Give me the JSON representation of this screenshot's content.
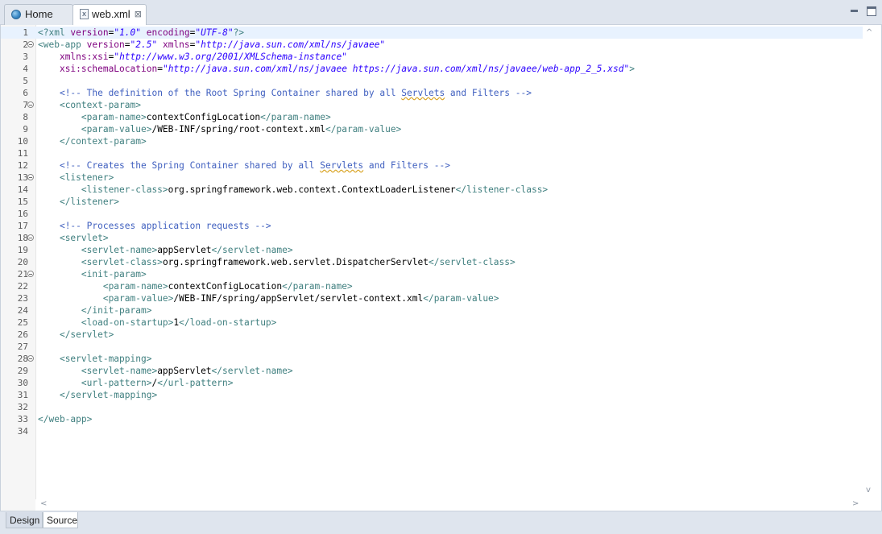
{
  "tabs": {
    "home": "Home",
    "file": "web.xml",
    "close_glyph": "⊠",
    "file_icon_glyph": "x"
  },
  "bottom_tabs": {
    "design": "Design",
    "source": "Source"
  },
  "scroll_glyphs": {
    "up": "^",
    "down": "v",
    "left": "<",
    "right": ">"
  },
  "colors": {
    "tag": "#3f7f7f",
    "attribute": "#7f007f",
    "attribute_value": "#2a00ff",
    "comment": "#3f5fbf",
    "current_line": "#e8f2fe"
  },
  "editor": {
    "current_line": 1,
    "lines": [
      {
        "n": "1",
        "fold": false,
        "parts": [
          [
            "tag",
            "<?xml "
          ],
          [
            "attr",
            "version"
          ],
          [
            "plain",
            "="
          ],
          [
            "val",
            "\"1.0\""
          ],
          [
            "plain",
            " "
          ],
          [
            "attr",
            "encoding"
          ],
          [
            "plain",
            "="
          ],
          [
            "val",
            "\"UTF-8\""
          ],
          [
            "tag",
            "?>"
          ]
        ]
      },
      {
        "n": "2",
        "fold": true,
        "parts": [
          [
            "tag",
            "<web-app "
          ],
          [
            "attr",
            "version"
          ],
          [
            "plain",
            "="
          ],
          [
            "val",
            "\"2.5\""
          ],
          [
            "plain",
            " "
          ],
          [
            "attr",
            "xmlns"
          ],
          [
            "plain",
            "="
          ],
          [
            "val",
            "\"http://java.sun.com/xml/ns/javaee\""
          ]
        ]
      },
      {
        "n": "3",
        "fold": false,
        "parts": [
          [
            "plain",
            "    "
          ],
          [
            "attr",
            "xmlns:xsi"
          ],
          [
            "plain",
            "="
          ],
          [
            "val",
            "\"http://www.w3.org/2001/XMLSchema-instance\""
          ]
        ]
      },
      {
        "n": "4",
        "fold": false,
        "parts": [
          [
            "plain",
            "    "
          ],
          [
            "attr",
            "xsi:schemaLocation"
          ],
          [
            "plain",
            "="
          ],
          [
            "val",
            "\"http://java.sun.com/xml/ns/javaee https://java.sun.com/xml/ns/javaee/web-app_2_5.xsd\""
          ],
          [
            "tag",
            ">"
          ]
        ]
      },
      {
        "n": "5",
        "fold": false,
        "parts": []
      },
      {
        "n": "6",
        "fold": false,
        "parts": [
          [
            "plain",
            "    "
          ],
          [
            "cmt",
            "<!-- The definition of the Root Spring Container shared by all "
          ],
          [
            "cmtspell",
            "Servlets"
          ],
          [
            "cmt",
            " and Filters -->"
          ]
        ]
      },
      {
        "n": "7",
        "fold": true,
        "parts": [
          [
            "plain",
            "    "
          ],
          [
            "tag",
            "<context-param>"
          ]
        ]
      },
      {
        "n": "8",
        "fold": false,
        "parts": [
          [
            "plain",
            "        "
          ],
          [
            "tag",
            "<param-name>"
          ],
          [
            "plain",
            "contextConfigLocation"
          ],
          [
            "tag",
            "</param-name>"
          ]
        ]
      },
      {
        "n": "9",
        "fold": false,
        "parts": [
          [
            "plain",
            "        "
          ],
          [
            "tag",
            "<param-value>"
          ],
          [
            "plain",
            "/WEB-INF/spring/root-context.xml"
          ],
          [
            "tag",
            "</param-value>"
          ]
        ]
      },
      {
        "n": "10",
        "fold": false,
        "parts": [
          [
            "plain",
            "    "
          ],
          [
            "tag",
            "</context-param>"
          ]
        ]
      },
      {
        "n": "11",
        "fold": false,
        "parts": []
      },
      {
        "n": "12",
        "fold": false,
        "parts": [
          [
            "plain",
            "    "
          ],
          [
            "cmt",
            "<!-- Creates the Spring Container shared by all "
          ],
          [
            "cmtspell",
            "Servlets"
          ],
          [
            "cmt",
            " and Filters -->"
          ]
        ]
      },
      {
        "n": "13",
        "fold": true,
        "parts": [
          [
            "plain",
            "    "
          ],
          [
            "tag",
            "<listener>"
          ]
        ]
      },
      {
        "n": "14",
        "fold": false,
        "parts": [
          [
            "plain",
            "        "
          ],
          [
            "tag",
            "<listener-class>"
          ],
          [
            "plain",
            "org.springframework.web.context.ContextLoaderListener"
          ],
          [
            "tag",
            "</listener-class>"
          ]
        ]
      },
      {
        "n": "15",
        "fold": false,
        "parts": [
          [
            "plain",
            "    "
          ],
          [
            "tag",
            "</listener>"
          ]
        ]
      },
      {
        "n": "16",
        "fold": false,
        "parts": []
      },
      {
        "n": "17",
        "fold": false,
        "parts": [
          [
            "plain",
            "    "
          ],
          [
            "cmt",
            "<!-- Processes application requests -->"
          ]
        ]
      },
      {
        "n": "18",
        "fold": true,
        "parts": [
          [
            "plain",
            "    "
          ],
          [
            "tag",
            "<servlet>"
          ]
        ]
      },
      {
        "n": "19",
        "fold": false,
        "parts": [
          [
            "plain",
            "        "
          ],
          [
            "tag",
            "<servlet-name>"
          ],
          [
            "plain",
            "appServlet"
          ],
          [
            "tag",
            "</servlet-name>"
          ]
        ]
      },
      {
        "n": "20",
        "fold": false,
        "parts": [
          [
            "plain",
            "        "
          ],
          [
            "tag",
            "<servlet-class>"
          ],
          [
            "plain",
            "org.springframework.web.servlet.DispatcherServlet"
          ],
          [
            "tag",
            "</servlet-class>"
          ]
        ]
      },
      {
        "n": "21",
        "fold": true,
        "parts": [
          [
            "plain",
            "        "
          ],
          [
            "tag",
            "<init-param>"
          ]
        ]
      },
      {
        "n": "22",
        "fold": false,
        "parts": [
          [
            "plain",
            "            "
          ],
          [
            "tag",
            "<param-name>"
          ],
          [
            "plain",
            "contextConfigLocation"
          ],
          [
            "tag",
            "</param-name>"
          ]
        ]
      },
      {
        "n": "23",
        "fold": false,
        "parts": [
          [
            "plain",
            "            "
          ],
          [
            "tag",
            "<param-value>"
          ],
          [
            "plain",
            "/WEB-INF/spring/appServlet/servlet-context.xml"
          ],
          [
            "tag",
            "</param-value>"
          ]
        ]
      },
      {
        "n": "24",
        "fold": false,
        "parts": [
          [
            "plain",
            "        "
          ],
          [
            "tag",
            "</init-param>"
          ]
        ]
      },
      {
        "n": "25",
        "fold": false,
        "parts": [
          [
            "plain",
            "        "
          ],
          [
            "tag",
            "<load-on-startup>"
          ],
          [
            "plain",
            "1"
          ],
          [
            "tag",
            "</load-on-startup>"
          ]
        ]
      },
      {
        "n": "26",
        "fold": false,
        "parts": [
          [
            "plain",
            "    "
          ],
          [
            "tag",
            "</servlet>"
          ]
        ]
      },
      {
        "n": "27",
        "fold": false,
        "parts": []
      },
      {
        "n": "28",
        "fold": true,
        "parts": [
          [
            "plain",
            "    "
          ],
          [
            "tag",
            "<servlet-mapping>"
          ]
        ]
      },
      {
        "n": "29",
        "fold": false,
        "parts": [
          [
            "plain",
            "        "
          ],
          [
            "tag",
            "<servlet-name>"
          ],
          [
            "plain",
            "appServlet"
          ],
          [
            "tag",
            "</servlet-name>"
          ]
        ]
      },
      {
        "n": "30",
        "fold": false,
        "parts": [
          [
            "plain",
            "        "
          ],
          [
            "tag",
            "<url-pattern>"
          ],
          [
            "plain",
            "/"
          ],
          [
            "tag",
            "</url-pattern>"
          ]
        ]
      },
      {
        "n": "31",
        "fold": false,
        "parts": [
          [
            "plain",
            "    "
          ],
          [
            "tag",
            "</servlet-mapping>"
          ]
        ]
      },
      {
        "n": "32",
        "fold": false,
        "parts": []
      },
      {
        "n": "33",
        "fold": false,
        "parts": [
          [
            "tag",
            "</web-app>"
          ]
        ]
      },
      {
        "n": "34",
        "fold": false,
        "parts": []
      }
    ]
  }
}
